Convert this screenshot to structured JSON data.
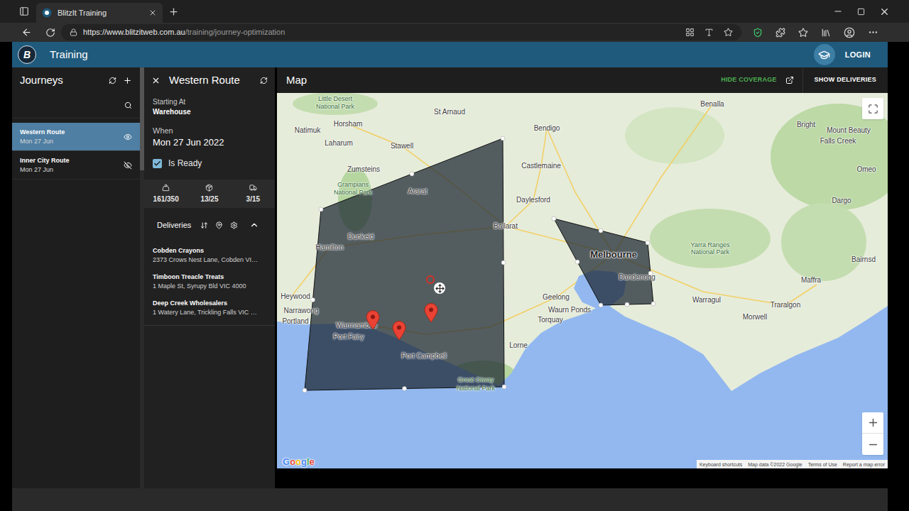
{
  "browser": {
    "tab_title": "BlitzIt Training",
    "url_host": "https://www.blitzitweb.com.au",
    "url_path": "/training/journey-optimization"
  },
  "app": {
    "logo": "B",
    "title": "Training",
    "login": "LOGIN"
  },
  "journeys": {
    "title": "Journeys",
    "items": [
      {
        "name": "Western Route",
        "date": "Mon 27 Jun",
        "selected": true,
        "visible": true
      },
      {
        "name": "Inner City Route",
        "date": "Mon 27 Jun",
        "selected": false,
        "visible": false
      }
    ]
  },
  "journey": {
    "title": "Western Route",
    "starting_label": "Starting At",
    "starting_value": "Warehouse",
    "when_label": "When",
    "when_value": "Mon 27 Jun 2022",
    "ready_label": "Is Ready",
    "ready": true,
    "stats": [
      {
        "kind": "weight",
        "value": "161/350"
      },
      {
        "kind": "packages",
        "value": "13/25"
      },
      {
        "kind": "vehicles",
        "value": "3/15"
      }
    ],
    "deliveries_title": "Deliveries",
    "deliveries_expanded": true,
    "deliveries": [
      {
        "name": "Cobden Crayons",
        "address": "2373 Crows Nest Lane, Cobden VI…"
      },
      {
        "name": "Timboon Treacle Treats",
        "address": "1 Maple St, Syrupy Bld VIC 4000"
      },
      {
        "name": "Deep Creek Wholesalers",
        "address": "1 Watery Lane, Trickling Falls VIC …"
      }
    ]
  },
  "map": {
    "title": "Map",
    "hide_coverage": "HIDE COVERAGE",
    "show_deliveries": "SHOW DELIVERIES",
    "coverage_visible": true,
    "labels": [
      {
        "text": "Little Desert",
        "kind": "park"
      },
      {
        "text": "National Park",
        "kind": "park"
      },
      {
        "text": "St Arnaud",
        "kind": "town"
      },
      {
        "text": "Benalla",
        "kind": "town"
      },
      {
        "text": "Horsham",
        "kind": "town"
      },
      {
        "text": "Natimuk",
        "kind": "town"
      },
      {
        "text": "Laharum",
        "kind": "town"
      },
      {
        "text": "Bendigo",
        "kind": "town"
      },
      {
        "text": "Stawell",
        "kind": "town"
      },
      {
        "text": "Castlemaine",
        "kind": "town"
      },
      {
        "text": "Zumsteins",
        "kind": "town"
      },
      {
        "text": "Grampians",
        "kind": "park"
      },
      {
        "text": "National Park",
        "kind": "park"
      },
      {
        "text": "Ararat",
        "kind": "town"
      },
      {
        "text": "Daylesford",
        "kind": "town"
      },
      {
        "text": "Bright",
        "kind": "town"
      },
      {
        "text": "Mount Beauty",
        "kind": "town"
      },
      {
        "text": "Falls Creek",
        "kind": "town"
      },
      {
        "text": "Omeo",
        "kind": "town"
      },
      {
        "text": "Dargo",
        "kind": "town"
      },
      {
        "text": "Dunkeld",
        "kind": "town"
      },
      {
        "text": "Ballarat",
        "kind": "town"
      },
      {
        "text": "Hamilton",
        "kind": "town"
      },
      {
        "text": "Melbourne",
        "kind": "city"
      },
      {
        "text": "Yarra Ranges",
        "kind": "park"
      },
      {
        "text": "National Park",
        "kind": "park"
      },
      {
        "text": "Heywood",
        "kind": "town"
      },
      {
        "text": "Narrawong",
        "kind": "town"
      },
      {
        "text": "Portland",
        "kind": "town"
      },
      {
        "text": "Warrnamboo",
        "kind": "town"
      },
      {
        "text": "Port Fairy",
        "kind": "town"
      },
      {
        "text": "Port Campbell",
        "kind": "town"
      },
      {
        "text": "Great Otway",
        "kind": "park"
      },
      {
        "text": "National Park",
        "kind": "park"
      },
      {
        "text": "Lorne",
        "kind": "town"
      },
      {
        "text": "Geelong",
        "kind": "town"
      },
      {
        "text": "Waurn Ponds",
        "kind": "town"
      },
      {
        "text": "Torquay",
        "kind": "town"
      },
      {
        "text": "Dandenong",
        "kind": "town"
      },
      {
        "text": "Warragul",
        "kind": "town"
      },
      {
        "text": "Traralgon",
        "kind": "town"
      },
      {
        "text": "Morwell",
        "kind": "town"
      },
      {
        "text": "Maffra",
        "kind": "town"
      },
      {
        "text": "Bairnsd",
        "kind": "town"
      }
    ],
    "google": "Google",
    "attribution": [
      "Keyboard shortcuts",
      "Map data ©2022 Google",
      "Terms of Use",
      "Report a map error"
    ]
  }
}
